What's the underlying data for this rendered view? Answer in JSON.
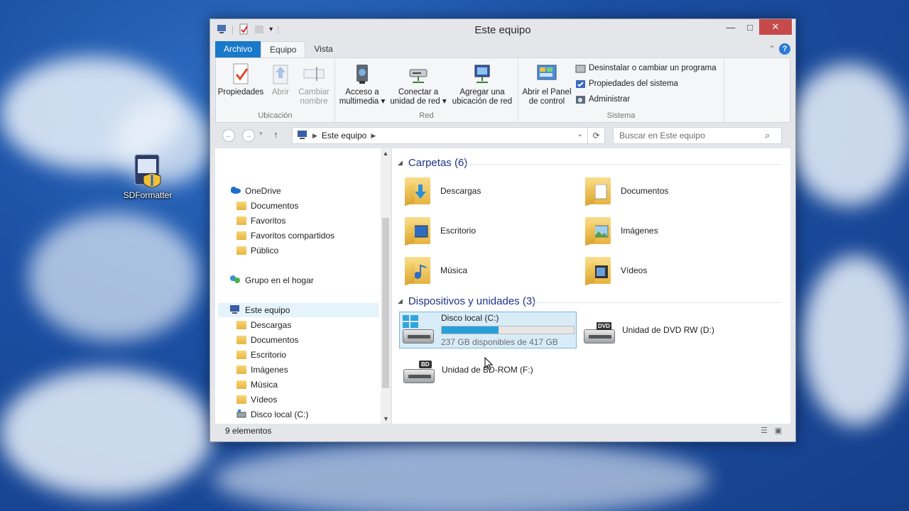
{
  "desktop": {
    "icon_label": "SDFormatter"
  },
  "window": {
    "title": "Este equipo",
    "minimize": "—",
    "maximize": "□",
    "close": "✕"
  },
  "ribbon": {
    "tabs": [
      "Archivo",
      "Equipo",
      "Vista"
    ],
    "groups": {
      "ubicacion": {
        "name": "Ubicación",
        "buttons": [
          "Propiedades",
          "Abrir",
          "Cambiar\nnombre"
        ]
      },
      "red": {
        "name": "Red",
        "buttons": [
          "Acceso a\nmultimedia ▾",
          "Conectar a\nunidad de red ▾",
          "Agregar una\nubicación de red"
        ]
      },
      "sistema": {
        "name": "Sistema",
        "big_button": "Abrir el Panel\nde control",
        "small_buttons": [
          "Desinstalar o cambiar un programa",
          "Propiedades del sistema",
          "Administrar"
        ]
      }
    },
    "help": "?"
  },
  "address": {
    "path": "Este equipo",
    "search_placeholder": "Buscar en Este equipo"
  },
  "nav": {
    "onedrive": "OneDrive",
    "onedrive_items": [
      "Documentos",
      "Favoritos",
      "Favoritos compartidos",
      "Público"
    ],
    "homegroup": "Grupo en el hogar",
    "this_pc": "Este equipo",
    "pc_items": [
      "Descargas",
      "Documentos",
      "Escritorio",
      "Imágenes",
      "Música",
      "Vídeos",
      "Disco local (C:)"
    ]
  },
  "content": {
    "folders_header": "Carpetas (6)",
    "folders": [
      "Descargas",
      "Documentos",
      "Escritorio",
      "Imágenes",
      "Música",
      "Vídeos"
    ],
    "devices_header": "Dispositivos y unidades (3)",
    "drive_c": {
      "name": "Disco local (C:)",
      "free": "237 GB disponibles de 417 GB",
      "used_fraction": 0.43
    },
    "dvd": {
      "name": "Unidad de DVD RW (D:)",
      "badge": "DVD"
    },
    "bd": {
      "name": "Unidad de BD-ROM (F:)",
      "badge": "BD"
    }
  },
  "status": {
    "items": "9 elementos"
  },
  "colors": {
    "accent": "#1979ca",
    "selection": "#d8ecf8",
    "drive_bar": "#26a0da"
  }
}
